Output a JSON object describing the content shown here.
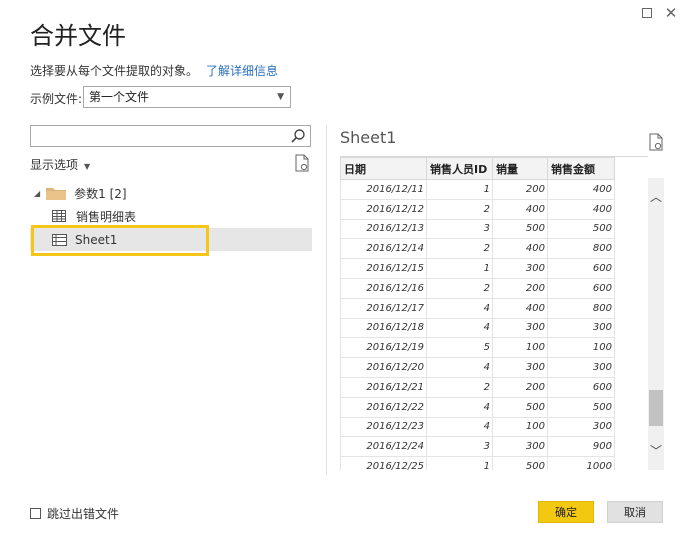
{
  "window": {
    "maximize_icon": "maximize-icon",
    "close_glyph": "✕"
  },
  "dialog": {
    "title": "合并文件",
    "description": "选择要从每个文件提取的对象。",
    "learn_more_link": "了解详细信息"
  },
  "example_file": {
    "label": "示例文件:",
    "selected": "第一个文件"
  },
  "navigator": {
    "search_placeholder": "",
    "display_options_label": "显示选项",
    "folder": {
      "label": "参数1 [2]"
    },
    "items": [
      {
        "label": "销售明细表",
        "icon": "table-icon"
      },
      {
        "label": "Sheet1",
        "icon": "sheet-icon",
        "selected": true
      }
    ]
  },
  "preview": {
    "title": "Sheet1",
    "columns": [
      "日期",
      "销售人员ID",
      "销量",
      "销售金额"
    ],
    "rows": [
      [
        "2016/12/11",
        "1",
        "200",
        "400"
      ],
      [
        "2016/12/12",
        "2",
        "400",
        "400"
      ],
      [
        "2016/12/13",
        "3",
        "500",
        "500"
      ],
      [
        "2016/12/14",
        "2",
        "400",
        "800"
      ],
      [
        "2016/12/15",
        "1",
        "300",
        "600"
      ],
      [
        "2016/12/16",
        "2",
        "200",
        "600"
      ],
      [
        "2016/12/17",
        "4",
        "400",
        "800"
      ],
      [
        "2016/12/18",
        "4",
        "300",
        "300"
      ],
      [
        "2016/12/19",
        "5",
        "100",
        "100"
      ],
      [
        "2016/12/20",
        "4",
        "300",
        "300"
      ],
      [
        "2016/12/21",
        "2",
        "200",
        "600"
      ],
      [
        "2016/12/22",
        "4",
        "500",
        "500"
      ],
      [
        "2016/12/23",
        "4",
        "100",
        "300"
      ],
      [
        "2016/12/24",
        "3",
        "300",
        "900"
      ],
      [
        "2016/12/25",
        "1",
        "500",
        "1000"
      ]
    ]
  },
  "footer": {
    "skip_errors_label": "跳过出错文件",
    "ok_label": "确定",
    "cancel_label": "取消"
  },
  "colors": {
    "accent_yellow": "#f2c811",
    "highlight_border": "#f5c518",
    "link_blue": "#2a6ebb"
  }
}
